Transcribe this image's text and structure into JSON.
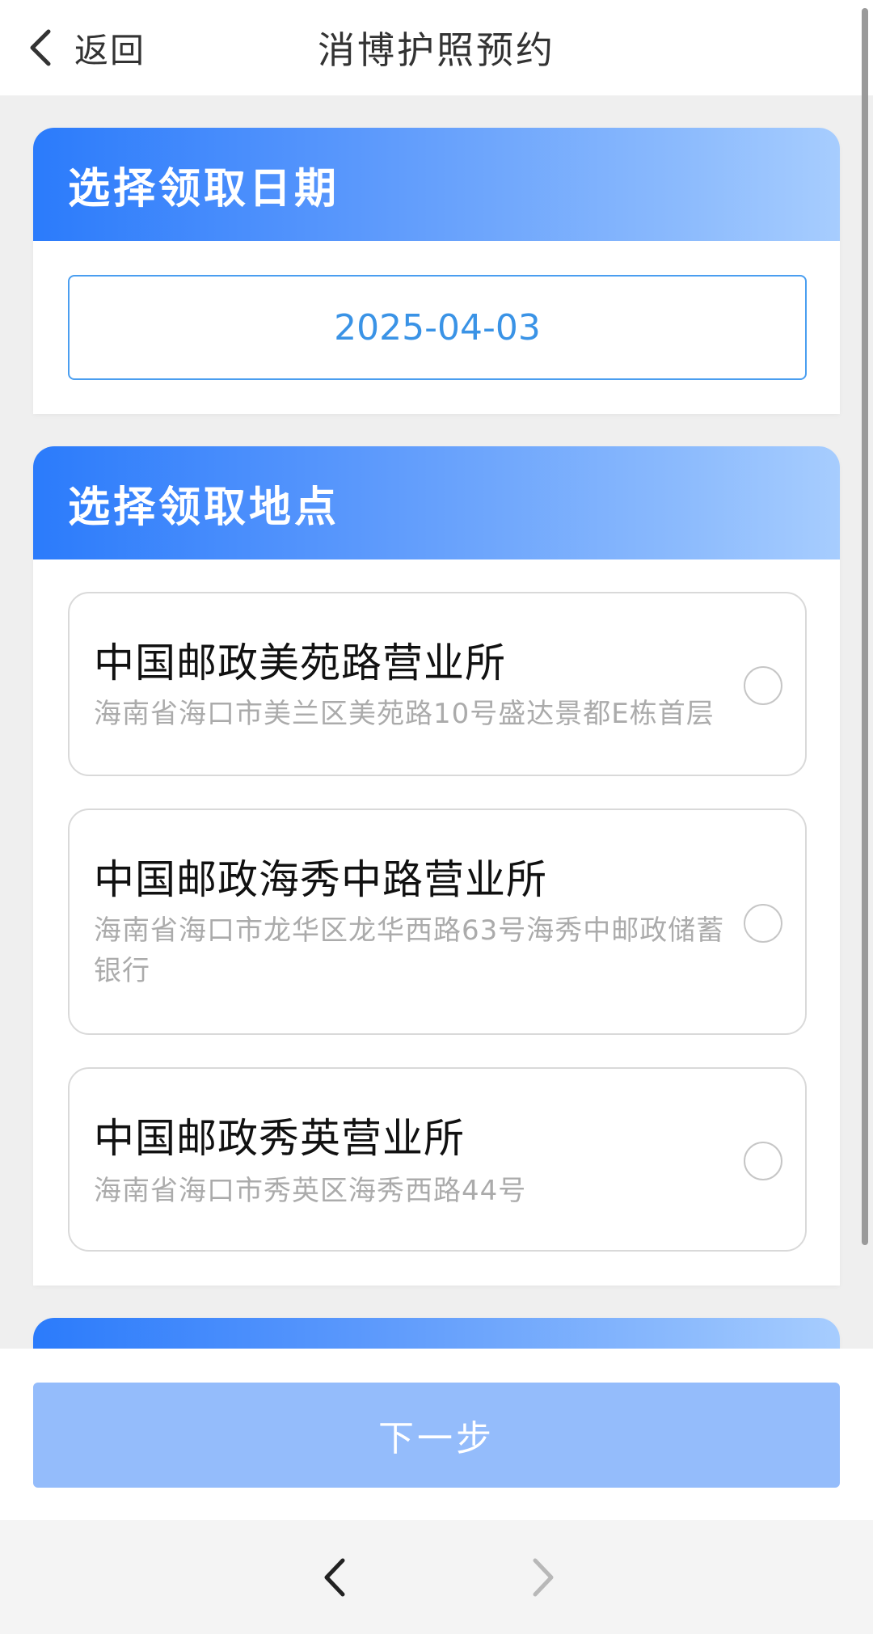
{
  "header": {
    "back_label": "返回",
    "title": "消博护照预约"
  },
  "date_section": {
    "title": "选择领取日期",
    "selected_date": "2025-04-03"
  },
  "location_section": {
    "title": "选择领取地点",
    "options": [
      {
        "name": "中国邮政美苑路营业所",
        "address": "海南省海口市美兰区美苑路10号盛达景都E栋首层",
        "selected": false
      },
      {
        "name": "中国邮政海秀中路营业所",
        "address": "海南省海口市龙华区龙华西路63号海秀中邮政储蓄银行",
        "selected": false
      },
      {
        "name": "中国邮政秀英营业所",
        "address": "海南省海口市秀英区海秀西路44号",
        "selected": false
      }
    ]
  },
  "actions": {
    "next_label": "下一步"
  },
  "colors": {
    "accent_blue": "#2b7bfb",
    "date_text": "#3a93e6",
    "next_button_disabled": "#94bcfb"
  },
  "icons": {
    "back": "chevron-left-icon",
    "nav_back": "chevron-left-icon",
    "nav_forward": "chevron-right-icon"
  }
}
